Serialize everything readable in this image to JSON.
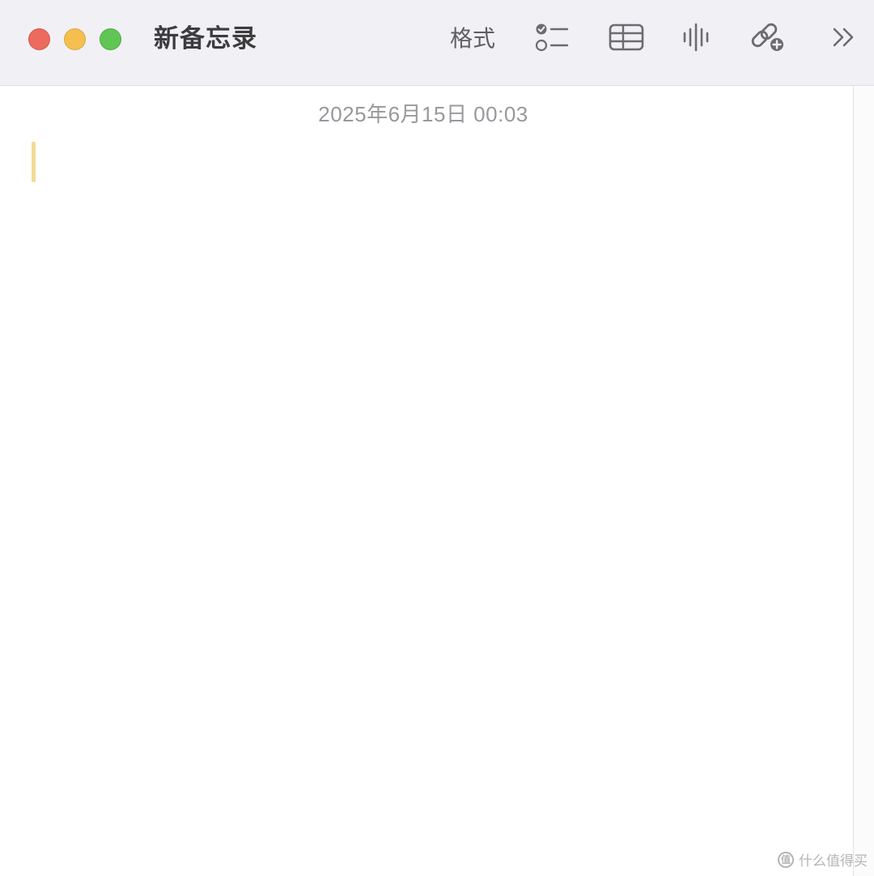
{
  "window": {
    "title": "新备忘录"
  },
  "toolbar": {
    "format_label": "格式",
    "icons": [
      "checklist-icon",
      "table-icon",
      "audio-waveform-icon",
      "link-add-icon",
      "chevrons-right-icon"
    ]
  },
  "note": {
    "date": "2025年6月15日 00:03",
    "body": ""
  },
  "watermark": {
    "text": "什么值得买",
    "icon_text": "值"
  },
  "colors": {
    "titlebar_bg": "#f1f0f5",
    "close": "#ec6a5e",
    "minimize": "#f4bf4f",
    "zoom": "#61c554",
    "caret": "#f1dc94"
  }
}
